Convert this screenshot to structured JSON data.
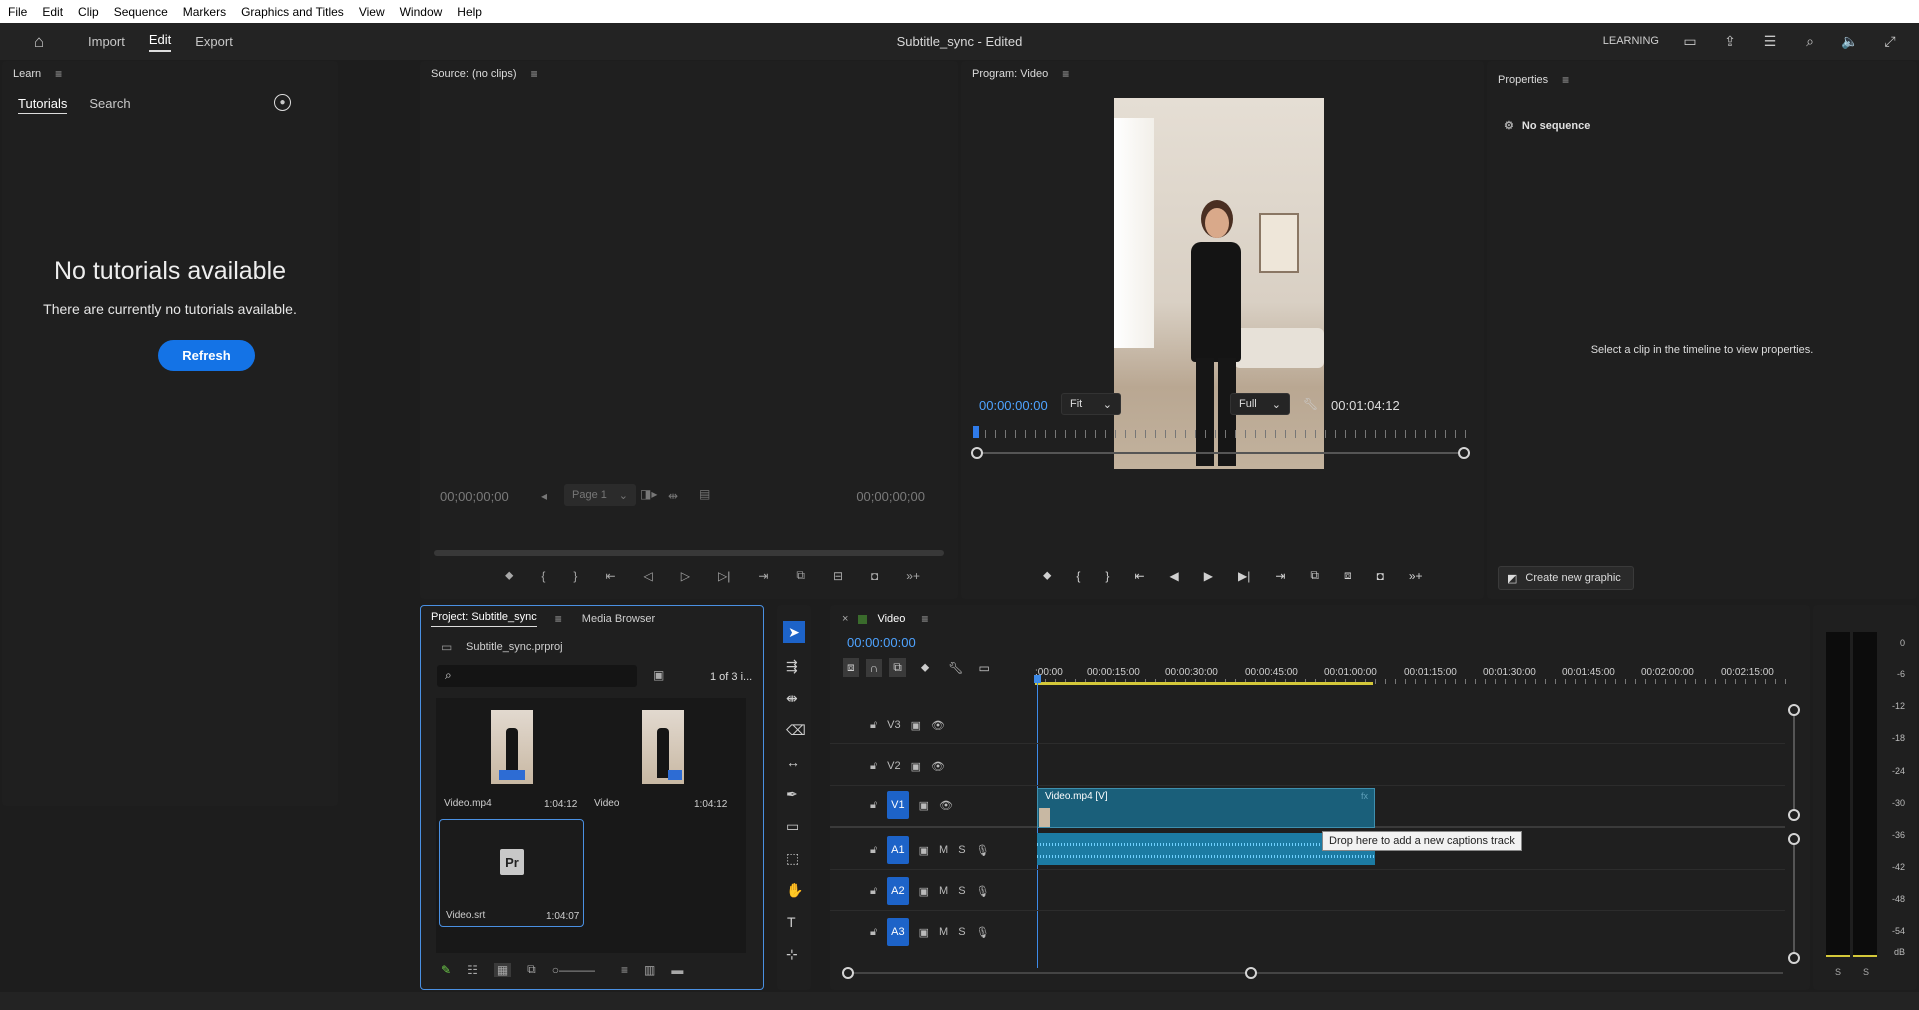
{
  "menu": [
    "File",
    "Edit",
    "Clip",
    "Sequence",
    "Markers",
    "Graphics and Titles",
    "View",
    "Window",
    "Help"
  ],
  "app": {
    "workspaces": [
      "Import",
      "Edit",
      "Export"
    ],
    "active": "Edit",
    "title": "Subtitle_sync - Edited",
    "learning": "LEARNING"
  },
  "learn": {
    "header": "Learn",
    "tabs": [
      "Tutorials",
      "Search"
    ],
    "empty_title": "No tutorials available",
    "empty_sub": "There are currently no tutorials available.",
    "refresh": "Refresh"
  },
  "source": {
    "header": "Source: (no clips)",
    "tc_left": "00;00;00;00",
    "tc_right": "00;00;00;00",
    "page": "Page 1"
  },
  "program": {
    "header": "Program: Video",
    "tc_in": "00:00:00:00",
    "fit": "Fit",
    "quality": "Full",
    "duration": "00:01:04:12"
  },
  "properties": {
    "header": "Properties",
    "no_seq": "No sequence",
    "hint": "Select a clip in the timeline to view properties.",
    "create": "Create new graphic"
  },
  "project": {
    "tabs": [
      "Project: Subtitle_sync",
      "Media Browser"
    ],
    "file": "Subtitle_sync.prproj",
    "count": "1 of 3 i...",
    "items": [
      {
        "name": "Video.mp4",
        "dur": "1:04:12"
      },
      {
        "name": "Video",
        "dur": "1:04:12"
      },
      {
        "name": "Video.srt",
        "dur": "1:04:07"
      }
    ]
  },
  "timeline": {
    "header": "Video",
    "tc": "00:00:00:00",
    "ruler": [
      ":00:00",
      "00:00:15:00",
      "00:00:30:00",
      "00:00:45:00",
      "00:01:00:00",
      "00:01:15:00",
      "00:01:30:00",
      "00:01:45:00",
      "00:02:00:00",
      "00:02:15:00"
    ],
    "tracks": {
      "video": [
        "V3",
        "V2",
        "V1"
      ],
      "audio": [
        "A1",
        "A2",
        "A3"
      ]
    },
    "clip": "Video.mp4 [V]",
    "tooltip": "Drop here to add a new captions track",
    "m": "M",
    "s": "S"
  },
  "vu": {
    "ticks": [
      "0",
      "-6",
      "-12",
      "-18",
      "-24",
      "-30",
      "-36",
      "-42",
      "-48",
      "-54",
      "dB"
    ],
    "bottom": [
      "S",
      "S"
    ]
  },
  "colors": {
    "accent": "#1473e6",
    "timecode": "#4ea3ff",
    "clip": "#1a5f7a"
  }
}
